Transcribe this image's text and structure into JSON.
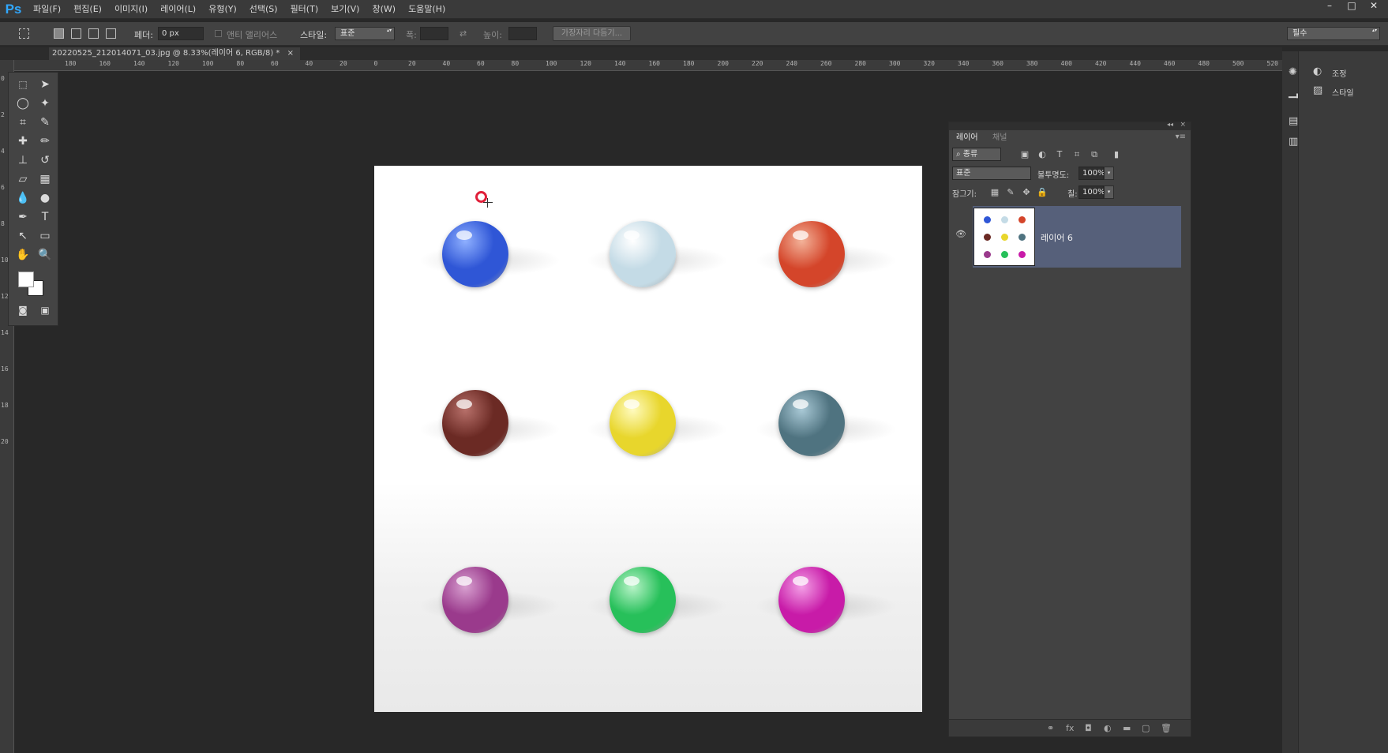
{
  "app": {
    "logo": "Ps",
    "menu": [
      "파일(F)",
      "편집(E)",
      "이미지(I)",
      "레이어(L)",
      "유형(Y)",
      "선택(S)",
      "필터(T)",
      "보기(V)",
      "창(W)",
      "도움말(H)"
    ],
    "window_controls": [
      "–",
      "□",
      "✕"
    ]
  },
  "options": {
    "feather_label": "페더:",
    "feather_value": "0 px",
    "antialias_label": "앤티 앨리어스",
    "style_label": "스타일:",
    "style_value": "표준",
    "width_label": "폭:",
    "height_label": "높이:",
    "refine_edge_button": "가장자리 다듬기...",
    "workspace_value": "필수"
  },
  "document": {
    "tab_title": "20220525_212014071_03.jpg @ 8.33%(레이어 6, RGB/8) *",
    "tab_close": "×",
    "ruler_h": [
      "180",
      "160",
      "140",
      "120",
      "100",
      "80",
      "60",
      "40",
      "20",
      "0",
      "20",
      "40",
      "60",
      "80",
      "100",
      "120",
      "140",
      "160",
      "180",
      "200",
      "220",
      "240",
      "260",
      "280",
      "300",
      "320",
      "340",
      "360",
      "380",
      "400",
      "420",
      "440",
      "460",
      "480",
      "500",
      "520"
    ],
    "ruler_v": [
      "0",
      "2",
      "4",
      "6",
      "8",
      "10",
      "12",
      "14",
      "16",
      "18",
      "20"
    ]
  },
  "tools": {
    "icons": [
      "marquee-icon",
      "move-icon",
      "lasso-icon",
      "magic-wand-icon",
      "crop-icon",
      "eyedropper-icon",
      "healing-brush-icon",
      "brush-icon",
      "clone-stamp-icon",
      "history-brush-icon",
      "eraser-icon",
      "gradient-icon",
      "blur-icon",
      "dodge-icon",
      "pen-icon",
      "type-icon",
      "path-selection-icon",
      "shape-icon",
      "hand-icon",
      "zoom-icon"
    ],
    "foreground_color": "#ffffff",
    "background_color": "#ffffff"
  },
  "canvas": {
    "marbles": [
      {
        "color": "#2f56d6",
        "highlight": "#8fb0ff"
      },
      {
        "color": "#c4dbe6",
        "highlight": "#ffffff"
      },
      {
        "color": "#d4452a",
        "highlight": "#f3b39a"
      },
      {
        "color": "#6b2a24",
        "highlight": "#b7706a"
      },
      {
        "color": "#e8d62c",
        "highlight": "#fffbc0"
      },
      {
        "color": "#4f7380",
        "highlight": "#a9c9d6"
      },
      {
        "color": "#9a3a8c",
        "highlight": "#d8a0d0"
      },
      {
        "color": "#27c05a",
        "highlight": "#b8f3c8"
      },
      {
        "color": "#c81ba8",
        "highlight": "#f3a0e6"
      }
    ]
  },
  "layers": {
    "tab_layers": "레이어",
    "tab_channels": "채널",
    "filter_kind": "종류",
    "blend_mode": "표준",
    "opacity_label": "불투명도:",
    "opacity_value": "100%",
    "lock_label": "잠그기:",
    "fill_label": "칠:",
    "fill_value": "100%",
    "layer_name": "레이어 6"
  },
  "dock": {
    "adjustments_label": "조정",
    "styles_label": "스타일"
  }
}
